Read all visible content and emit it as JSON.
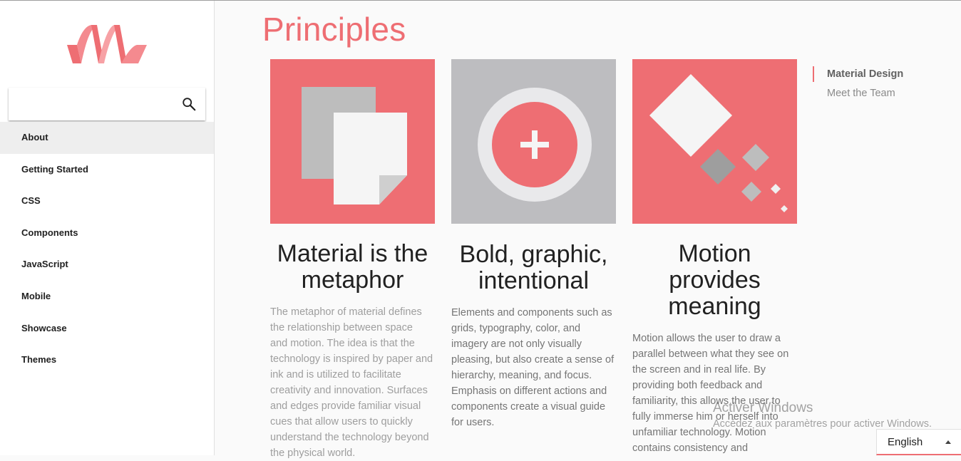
{
  "brand": {
    "logo_icon": "materialize-logo-icon",
    "accent_color": "#ee6e73"
  },
  "search": {
    "placeholder": "",
    "value": "",
    "icon": "search-icon"
  },
  "sidebar": {
    "items": [
      {
        "label": "About",
        "active": true
      },
      {
        "label": "Getting Started"
      },
      {
        "label": "CSS"
      },
      {
        "label": "Components"
      },
      {
        "label": "JavaScript"
      },
      {
        "label": "Mobile"
      },
      {
        "label": "Showcase"
      },
      {
        "label": "Themes"
      }
    ]
  },
  "main": {
    "title": "Principles",
    "cards": [
      {
        "icon": "paper-sheets-icon",
        "title_lines": [
          "Material is the",
          "metaphor"
        ],
        "text_lines": [
          "The metaphor of material defines",
          "the relationship between space",
          "and motion. The idea is that the",
          "technology is inspired by paper and",
          "ink and is utilized to facilitate",
          "creativity and innovation. Surfaces",
          "and edges provide familiar visual",
          "cues that allow users to quickly",
          "understand the technology beyond",
          "the physical world."
        ]
      },
      {
        "icon": "plus-circle-icon",
        "title_lines": [
          "Bold, graphic,",
          "intentional"
        ],
        "text_lines": [
          "Elements and components such as",
          "grids, typography, color, and",
          "imagery are not only visually",
          "pleasing, but also create a sense of",
          "hierarchy, meaning, and focus.",
          "Emphasis on different actions and",
          "components create a visual guide",
          "for users."
        ]
      },
      {
        "icon": "diamond-shapes-icon",
        "title_lines": [
          "Motion",
          "provides",
          "meaning"
        ],
        "text_lines": [
          "Motion allows the user to draw a",
          "parallel between what they see on",
          "the screen and in real life. By",
          "providing both feedback and",
          "familiarity, this allows the user to",
          "fully immerse him or herself into",
          "unfamiliar technology. Motion",
          "contains consistency and"
        ]
      }
    ]
  },
  "toc": {
    "items": [
      {
        "label": "Material Design",
        "active": true
      },
      {
        "label": "Meet the Team"
      }
    ]
  },
  "watermark": {
    "title": "Activer Windows",
    "subtitle": "Accédez aux paramètres pour activer Windows."
  },
  "language": {
    "selected": "English",
    "icon": "caret-up-icon"
  }
}
